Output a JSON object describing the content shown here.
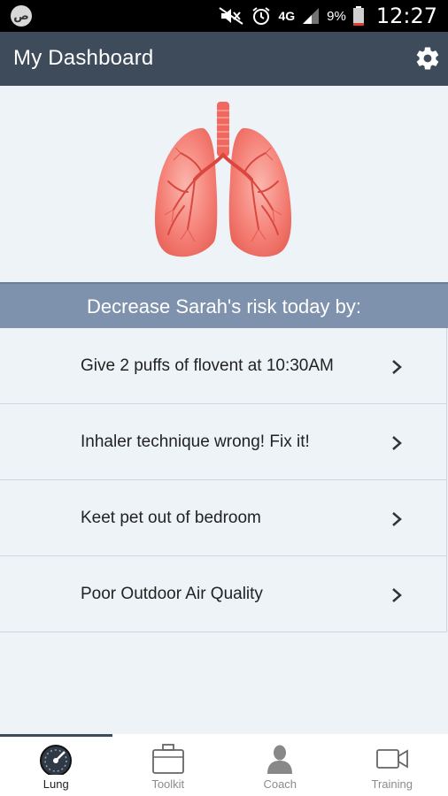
{
  "status_bar": {
    "app_badge": "ص",
    "network": "4G",
    "battery": "9%",
    "time": "12:27",
    "icons": [
      "app-icon",
      "mute-icon",
      "alarm-icon",
      "network-icon",
      "signal-icon",
      "battery-icon"
    ]
  },
  "app_bar": {
    "title": "My Dashboard",
    "settings_icon": "gear-icon"
  },
  "hero": {
    "image": "lungs-illustration",
    "color": "#f07670"
  },
  "section_header": {
    "text": "Decrease Sarah's risk today by:",
    "background": "#7e92ad"
  },
  "tasks": [
    {
      "label": "Give 2 puffs of flovent at 10:30AM"
    },
    {
      "label": "Inhaler technique wrong! Fix it!"
    },
    {
      "label": "Keet pet out of bedroom"
    },
    {
      "label": "Poor Outdoor Air Quality"
    }
  ],
  "bottom_nav": {
    "tabs": [
      {
        "label": "Lung",
        "icon": "speedometer-icon",
        "active": true
      },
      {
        "label": "Toolkit",
        "icon": "toolkit-icon",
        "active": false
      },
      {
        "label": "Coach",
        "icon": "person-icon",
        "active": false
      },
      {
        "label": "Training",
        "icon": "video-camera-icon",
        "active": false
      }
    ]
  },
  "colors": {
    "app_bar": "#3d4b5a",
    "background": "#eef3f8",
    "divider": "#cfd6de"
  }
}
